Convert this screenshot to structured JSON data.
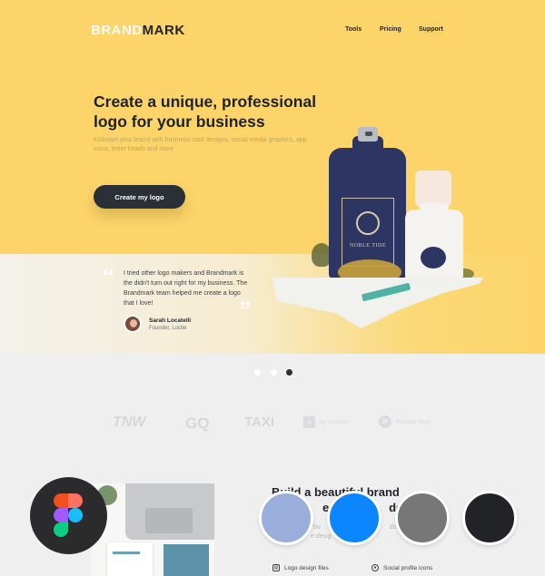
{
  "header": {
    "logo": {
      "brand": "BRAND",
      "mark": "MARK"
    },
    "nav": [
      {
        "label": "Tools"
      },
      {
        "label": "Pricing"
      },
      {
        "label": "Support"
      }
    ]
  },
  "hero": {
    "headline": "Create a unique, professional logo for your business",
    "subtext": "Kickstart your brand with business card designs, social media graphics, app icons, letter heads and more",
    "cta_label": "Create my logo",
    "product_label": "NOBLE TIDE"
  },
  "testimonial": {
    "open_quote": "“",
    "close_quote": "”",
    "text": "I tried other logo makers and Brandmark is the didn't turn out right for my business. The Brandmark team helped me create a logo that I love!",
    "author": "Sarah Locatelli",
    "role": "Founder, Loctie",
    "slides": 3,
    "active_slide": 3
  },
  "press": [
    {
      "label": "TNW"
    },
    {
      "label": "GQ"
    },
    {
      "label": "TAXI"
    },
    {
      "label": "by InVision",
      "icon": "in"
    },
    {
      "label": "Product Hunt",
      "icon": "P"
    }
  ],
  "features_section": {
    "title": "Build a beautiful brand ... an ... dget",
    "title_line1": "Build a beautiful brand",
    "title_line2": "e ar",
    "title_line3": "dget",
    "sub_line1": "bu",
    "sub_line2": "ds of",
    "sub_line3": "e desig",
    "features": [
      {
        "label": "Logo design files",
        "icon": "file-icon"
      },
      {
        "label": "Social profile icons",
        "icon": "profile-icon"
      }
    ]
  },
  "overlay": {
    "icon": "figma-icon",
    "swatches": [
      "#9aaedc",
      "#0c86ff",
      "#777777",
      "#222326"
    ]
  }
}
